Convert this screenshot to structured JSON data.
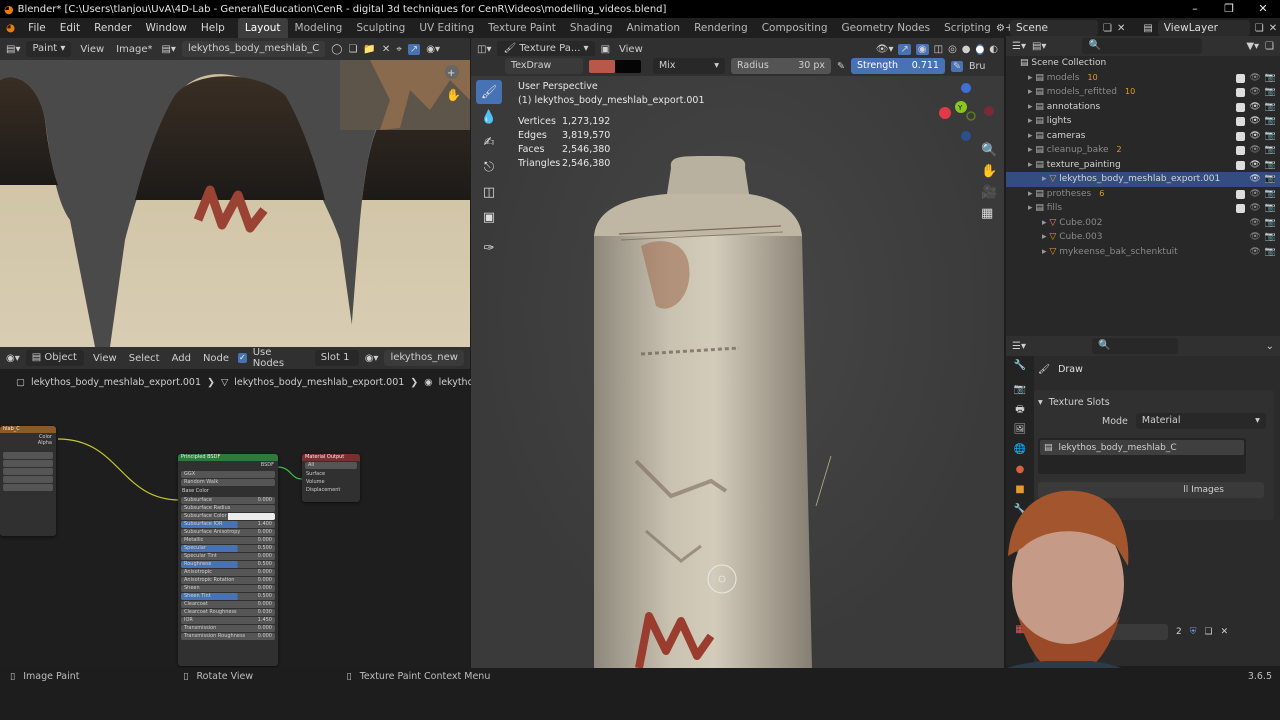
{
  "window": {
    "title": "Blender* [C:\\Users\\tlanjou\\UvA\\4D-Lab - General\\Education\\CenR - digital 3d techniques for CenR\\Videos\\modelling_videos.blend]",
    "controls": [
      "–",
      "❐",
      "✕"
    ]
  },
  "menu": [
    "File",
    "Edit",
    "Render",
    "Window",
    "Help"
  ],
  "workspaces": [
    "Layout",
    "Modeling",
    "Sculpting",
    "UV Editing",
    "Texture Paint",
    "Shading",
    "Animation",
    "Rendering",
    "Compositing",
    "Geometry Nodes",
    "Scripting"
  ],
  "active_workspace": "Layout",
  "add_tab": "+",
  "scene": "Scene",
  "view_layer": "ViewLayer",
  "image_editor": {
    "mode": "Paint",
    "menus": [
      "View",
      "Image*"
    ],
    "image_name": "lekythos_body_meshlab_C"
  },
  "node_editor": {
    "object_mode": "Object",
    "menus": [
      "View",
      "Select",
      "Add",
      "Node"
    ],
    "use_nodes_label": "Use Nodes",
    "slot": "Slot 1",
    "material": "lekythos_new",
    "breadcrumb": [
      "lekythos_body_meshlab_export.001",
      "lekythos_body_meshlab_export.001",
      "lekythos_new"
    ],
    "image_node": {
      "title": "hlab_C",
      "outputs": [
        "Color",
        "Alpha"
      ]
    },
    "bsdf": {
      "title": "Principled BSDF",
      "output": "BSDF",
      "dists": [
        "GGX",
        "Random Walk"
      ],
      "base_color": "Base Color",
      "rows": [
        {
          "label": "Subsurface",
          "value": "0.000"
        },
        {
          "label": "Subsurface Radius",
          "value": ""
        },
        {
          "label": "Subsurface Color",
          "value": ""
        },
        {
          "label": "Subsurface IOR",
          "value": "1.400"
        },
        {
          "label": "Subsurface Anisotropy",
          "value": "0.000"
        },
        {
          "label": "Metallic",
          "value": "0.000"
        },
        {
          "label": "Specular",
          "value": "0.500"
        },
        {
          "label": "Specular Tint",
          "value": "0.000"
        },
        {
          "label": "Roughness",
          "value": "0.500"
        },
        {
          "label": "Anisotropic",
          "value": "0.000"
        },
        {
          "label": "Anisotropic Rotation",
          "value": "0.000"
        },
        {
          "label": "Sheen",
          "value": "0.000"
        },
        {
          "label": "Sheen Tint",
          "value": "0.500"
        },
        {
          "label": "Clearcoat",
          "value": "0.000"
        },
        {
          "label": "Clearcoat Roughness",
          "value": "0.030"
        },
        {
          "label": "IOR",
          "value": "1.450"
        },
        {
          "label": "Transmission",
          "value": "0.000"
        },
        {
          "label": "Transmission Roughness",
          "value": "0.000"
        }
      ]
    },
    "output_node": {
      "title": "Material Output",
      "target": "All",
      "inputs": [
        "Surface",
        "Volume",
        "Displacement"
      ]
    }
  },
  "viewport": {
    "header_label": "Texture Pa...",
    "view_menu": "View",
    "brush": "TexDraw",
    "blend": "Mix",
    "radius_label": "Radius",
    "radius_value": "30 px",
    "strength_label": "Strength",
    "strength_value": "0.711",
    "brush_tab": "Bru",
    "brush_color": "#b8574a",
    "perspective": "User Perspective",
    "object_name": "(1) lekythos_body_meshlab_export.001",
    "stats": [
      {
        "label": "Vertices",
        "value": "1,273,192"
      },
      {
        "label": "Edges",
        "value": "3,819,570"
      },
      {
        "label": "Faces",
        "value": "2,546,380"
      },
      {
        "label": "Triangles",
        "value": "2,546,380"
      }
    ],
    "axes": [
      "Z",
      "Y",
      "X"
    ]
  },
  "outliner": {
    "root": "Scene Collection",
    "items": [
      {
        "name": "models",
        "badge": "10",
        "dim": true,
        "depth": 1
      },
      {
        "name": "models_refitted",
        "badge": "10",
        "dim": true,
        "depth": 1
      },
      {
        "name": "annotations",
        "badge": "",
        "dim": false,
        "depth": 1
      },
      {
        "name": "lights",
        "badge": "",
        "dim": false,
        "depth": 1
      },
      {
        "name": "cameras",
        "badge": "",
        "dim": false,
        "depth": 1
      },
      {
        "name": "cleanup_bake",
        "badge": "2",
        "dim": true,
        "depth": 1
      },
      {
        "name": "texture_painting",
        "badge": "",
        "dim": false,
        "depth": 1
      },
      {
        "name": "lekythos_body_meshlab_export.001",
        "badge": "",
        "dim": false,
        "depth": 2,
        "selected": true
      },
      {
        "name": "protheses",
        "badge": "6",
        "dim": true,
        "depth": 1
      },
      {
        "name": "fills",
        "badge": "",
        "dim": true,
        "depth": 1
      },
      {
        "name": "Cube.002",
        "badge": "",
        "dim": true,
        "depth": 2
      },
      {
        "name": "Cube.003",
        "badge": "",
        "dim": true,
        "depth": 2
      },
      {
        "name": "mykeense_bak_schenktuit",
        "badge": "",
        "dim": true,
        "depth": 2
      }
    ]
  },
  "properties": {
    "tool": "Draw",
    "panel": "Texture Slots",
    "mode_label": "Mode",
    "mode_value": "Material",
    "slot_item": "lekythos_body_meshlab_C",
    "images_button": "ll Images",
    "texture_field": "TexD",
    "users_count": "2"
  },
  "status": {
    "items": [
      "Image Paint",
      "Rotate View",
      "Texture Paint Context Menu"
    ],
    "version": "3.6.5"
  }
}
